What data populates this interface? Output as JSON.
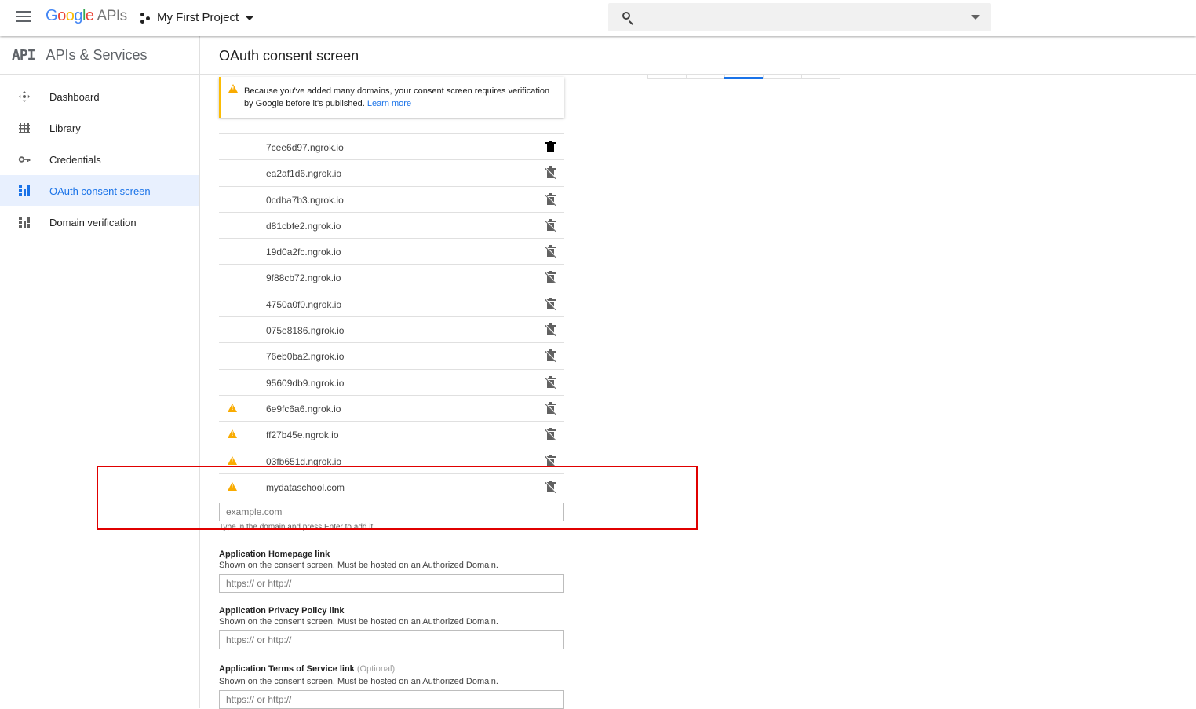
{
  "topbar": {
    "logo": {
      "g": "G",
      "o1": "o",
      "o2": "o",
      "g2": "g",
      "l": "l",
      "e": "e",
      "apis": "APIs"
    },
    "project_name": "My First Project",
    "search_placeholder": ""
  },
  "sidebar": {
    "logo_text": "API",
    "title": "APIs & Services",
    "items": [
      {
        "label": "Dashboard",
        "icon": "dashboard-icon"
      },
      {
        "label": "Library",
        "icon": "library-icon"
      },
      {
        "label": "Credentials",
        "icon": "key-icon"
      },
      {
        "label": "OAuth consent screen",
        "icon": "consent-icon",
        "active": true
      },
      {
        "label": "Domain verification",
        "icon": "domain-verification-icon"
      }
    ]
  },
  "main": {
    "title": "OAuth consent screen",
    "warning": {
      "text": "Because you've added many domains, your consent screen requires verification by Google before it's published.",
      "link": "Learn more"
    },
    "domains": [
      {
        "name": "7cee6d97.ngrok.io",
        "warn": false
      },
      {
        "name": "ea2af1d6.ngrok.io",
        "warn": false
      },
      {
        "name": "0cdba7b3.ngrok.io",
        "warn": false
      },
      {
        "name": "d81cbfe2.ngrok.io",
        "warn": false
      },
      {
        "name": "19d0a2fc.ngrok.io",
        "warn": false
      },
      {
        "name": "9f88cb72.ngrok.io",
        "warn": false
      },
      {
        "name": "4750a0f0.ngrok.io",
        "warn": false
      },
      {
        "name": "075e8186.ngrok.io",
        "warn": false
      },
      {
        "name": "76eb0ba2.ngrok.io",
        "warn": false
      },
      {
        "name": "95609db9.ngrok.io",
        "warn": false
      },
      {
        "name": "6e9fc6a6.ngrok.io",
        "warn": true
      },
      {
        "name": "ff27b45e.ngrok.io",
        "warn": true
      },
      {
        "name": "03fb651d.ngrok.io",
        "warn": true
      },
      {
        "name": "mydataschool.com",
        "warn": true
      }
    ],
    "domain_input": {
      "placeholder": "example.com",
      "hint": "Type in the domain and press Enter to add it"
    },
    "homepage": {
      "label": "Application Homepage link",
      "help": "Shown on the consent screen. Must be hosted on an Authorized Domain.",
      "placeholder": "https:// or http://"
    },
    "privacy": {
      "label": "Application Privacy Policy link",
      "help": "Shown on the consent screen. Must be hosted on an Authorized Domain.",
      "placeholder": "https:// or http://"
    },
    "terms": {
      "label": "Application Terms of Service link",
      "optional": "(Optional)",
      "help": "Shown on the consent screen. Must be hosted on an Authorized Domain.",
      "placeholder": "https:// or http://"
    }
  },
  "colors": {
    "accent": "#1a73e8",
    "warning": "#f9ab00",
    "highlight": "#e00000"
  }
}
